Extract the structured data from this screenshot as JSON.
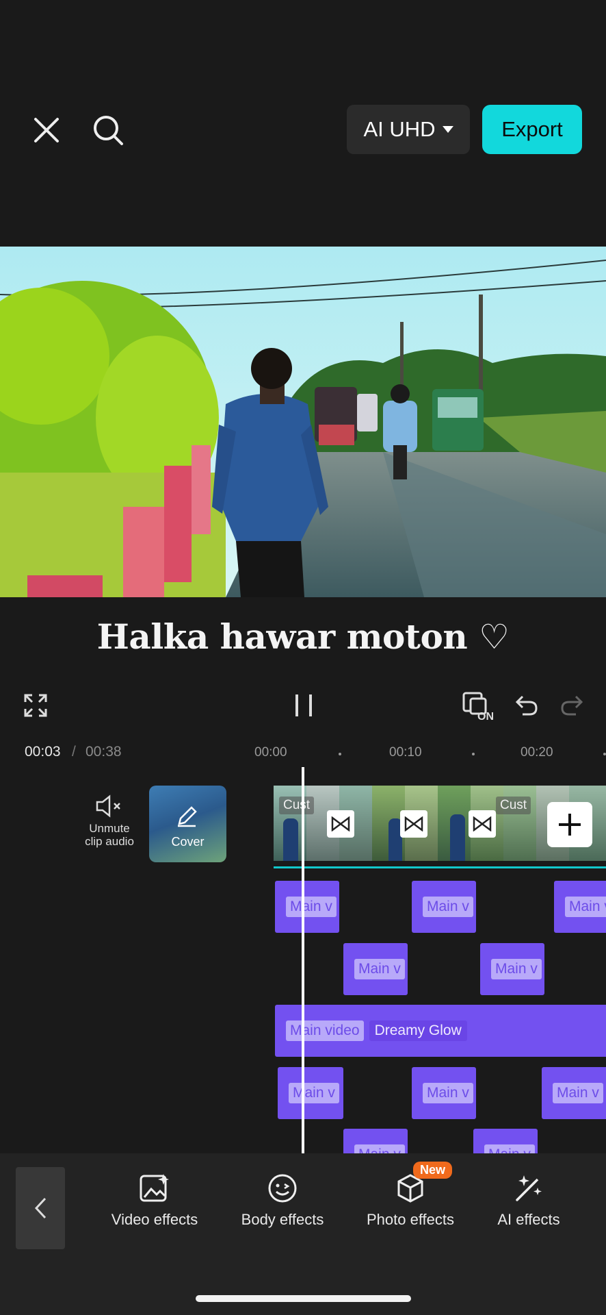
{
  "header": {
    "close_icon": "close-icon",
    "search_icon": "search-icon",
    "quality_label": "AI UHD",
    "export_label": "Export",
    "accent_color": "#12d8dc"
  },
  "preview": {
    "caption": "Halka hawar moton ♡"
  },
  "controls": {
    "fullscreen_icon": "fullscreen-icon",
    "pause_icon": "pause-icon",
    "on_label": "ON",
    "undo_icon": "undo-icon",
    "redo_icon": "redo-icon"
  },
  "time": {
    "current": "00:03",
    "separator": "/",
    "total": "00:38",
    "ruler": [
      "00:00",
      "00:10",
      "00:20"
    ]
  },
  "timeline": {
    "unmute_label_1": "Unmute",
    "unmute_label_2": "clip audio",
    "cover_label": "Cover",
    "clip_chip_label": "Cust",
    "effects": {
      "short_label": "Main v",
      "long_label": "Main video",
      "dreamy_label": "Dreamy Glow"
    },
    "effect_color": "#7351f0"
  },
  "toolbar": {
    "items": [
      {
        "label": "Video effects",
        "icon": "video-effects-icon"
      },
      {
        "label": "Body effects",
        "icon": "body-effects-icon"
      },
      {
        "label": "Photo effects",
        "icon": "photo-effects-icon",
        "badge": "New"
      },
      {
        "label": "AI effects",
        "icon": "ai-effects-icon"
      }
    ]
  }
}
